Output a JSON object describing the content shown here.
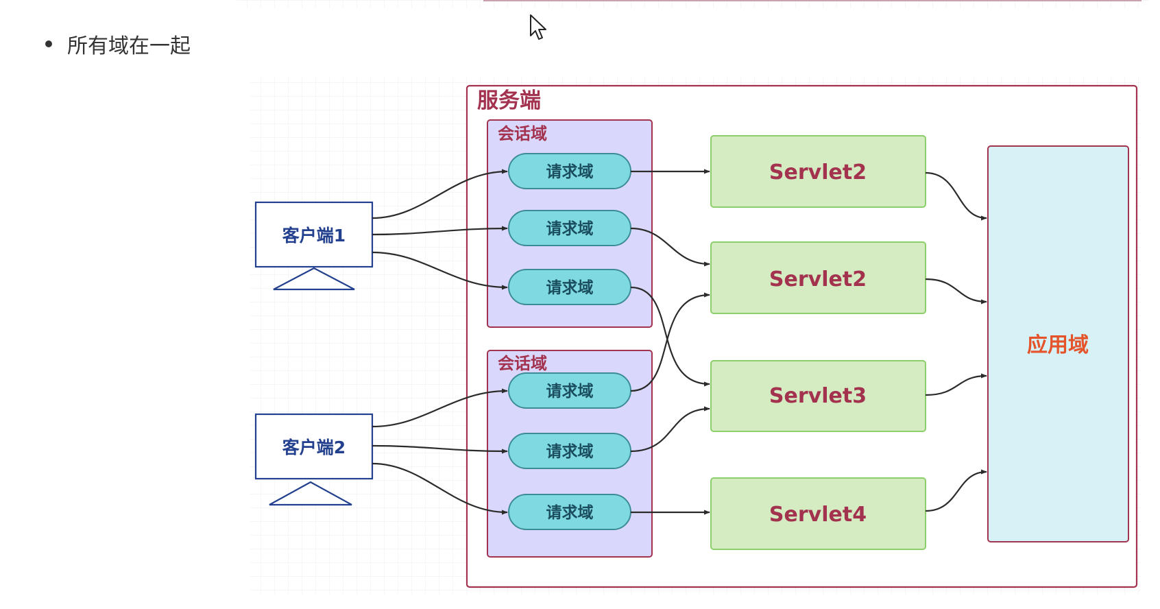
{
  "bullet": {
    "text": "所有域在一起"
  },
  "diagram": {
    "server_label": "服务端",
    "session_label": "会话域",
    "request_label": "请求域",
    "clients": [
      "客户端1",
      "客户端2"
    ],
    "servlets": [
      "Servlet2",
      "Servlet2",
      "Servlet3",
      "Servlet4"
    ],
    "app_label": "应用域"
  },
  "colors": {
    "server_border": "#a3324f",
    "session_fill": "#d9d7fb",
    "request_fill": "#7fd9e0",
    "servlet_fill": "#d5ecc2",
    "servlet_border": "#8ccf6a",
    "app_fill": "#d7f2f6",
    "client_border": "#23408e"
  }
}
